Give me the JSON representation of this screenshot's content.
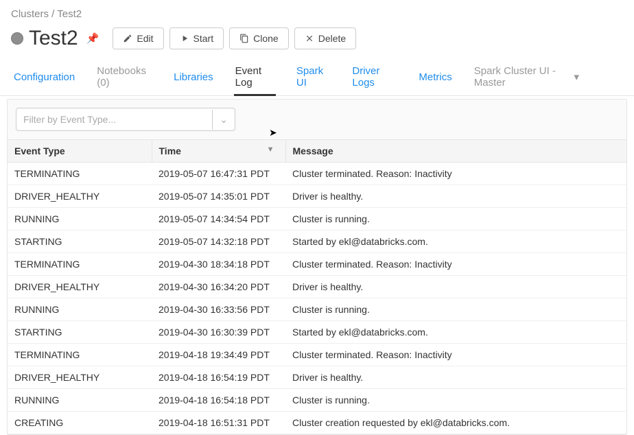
{
  "breadcrumb": "Clusters / Test2",
  "title": "Test2",
  "buttons": {
    "edit": "Edit",
    "start": "Start",
    "clone": "Clone",
    "delete": "Delete"
  },
  "tabs": {
    "configuration": "Configuration",
    "notebooks": "Notebooks (0)",
    "libraries": "Libraries",
    "eventlog": "Event Log",
    "sparkui": "Spark UI",
    "driverlogs": "Driver Logs",
    "metrics": "Metrics",
    "sparkmaster": "Spark Cluster UI - Master"
  },
  "filter": {
    "placeholder": "Filter by Event Type..."
  },
  "columns": {
    "type": "Event Type",
    "time": "Time",
    "message": "Message"
  },
  "rows": [
    {
      "type": "TERMINATING",
      "time": "2019-05-07 16:47:31 PDT",
      "message": "Cluster terminated. Reason: Inactivity"
    },
    {
      "type": "DRIVER_HEALTHY",
      "time": "2019-05-07 14:35:01 PDT",
      "message": "Driver is healthy."
    },
    {
      "type": "RUNNING",
      "time": "2019-05-07 14:34:54 PDT",
      "message": "Cluster is running."
    },
    {
      "type": "STARTING",
      "time": "2019-05-07 14:32:18 PDT",
      "message": "Started by ekl@databricks.com."
    },
    {
      "type": "TERMINATING",
      "time": "2019-04-30 18:34:18 PDT",
      "message": "Cluster terminated. Reason: Inactivity"
    },
    {
      "type": "DRIVER_HEALTHY",
      "time": "2019-04-30 16:34:20 PDT",
      "message": "Driver is healthy."
    },
    {
      "type": "RUNNING",
      "time": "2019-04-30 16:33:56 PDT",
      "message": "Cluster is running."
    },
    {
      "type": "STARTING",
      "time": "2019-04-30 16:30:39 PDT",
      "message": "Started by ekl@databricks.com."
    },
    {
      "type": "TERMINATING",
      "time": "2019-04-18 19:34:49 PDT",
      "message": "Cluster terminated. Reason: Inactivity"
    },
    {
      "type": "DRIVER_HEALTHY",
      "time": "2019-04-18 16:54:19 PDT",
      "message": "Driver is healthy."
    },
    {
      "type": "RUNNING",
      "time": "2019-04-18 16:54:18 PDT",
      "message": "Cluster is running."
    },
    {
      "type": "CREATING",
      "time": "2019-04-18 16:51:31 PDT",
      "message": "Cluster creation requested by ekl@databricks.com."
    }
  ]
}
